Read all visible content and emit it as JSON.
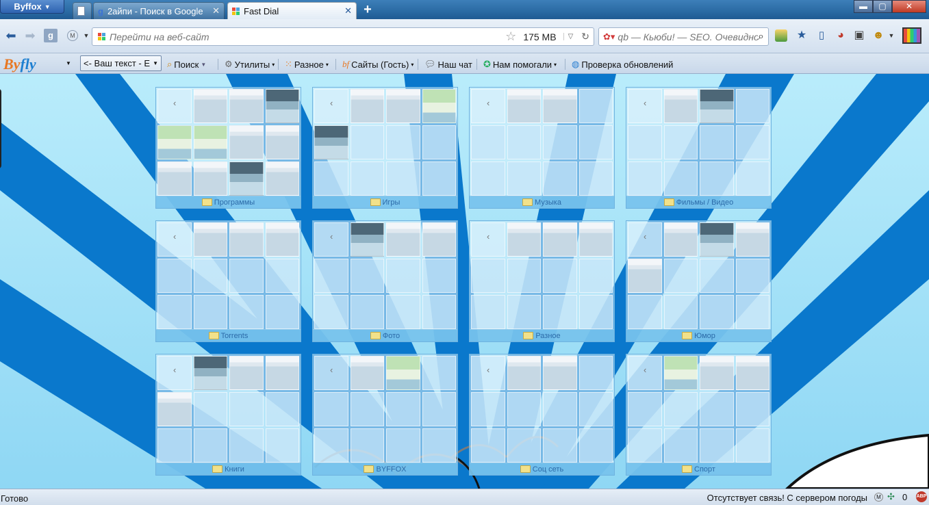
{
  "app": {
    "menu_label": "Byffox"
  },
  "tabs": [
    {
      "title": ""
    },
    {
      "title": "2айпи - Поиск в Google"
    },
    {
      "title": "Fast Dial"
    }
  ],
  "window_buttons": {
    "minimize": "▬",
    "maximize": "▢",
    "close": "✕"
  },
  "nav": {
    "url_placeholder": "Перейти на веб-сайт",
    "memory": "175 MB",
    "search_placeholder": "qb — Кьюби! — SEO. Очевидно",
    "identity_badge": "M"
  },
  "bookmarks": {
    "logo_b": "By",
    "logo_f": "fly",
    "your_text": "<- Ваш текст - E",
    "items": [
      {
        "label": "Поиск"
      },
      {
        "label": "Утилиты"
      },
      {
        "label": "Разное"
      },
      {
        "label": "Сайты (Гость)"
      },
      {
        "label": "Наш чат"
      },
      {
        "label": "Нам помогали"
      },
      {
        "label": "Проверка обновлений"
      }
    ]
  },
  "dials": [
    {
      "label": "Программы"
    },
    {
      "label": "Игры"
    },
    {
      "label": "Музыка"
    },
    {
      "label": "Фильмы / Видео"
    },
    {
      "label": "Torrents"
    },
    {
      "label": "Фото"
    },
    {
      "label": "Разное"
    },
    {
      "label": "Юмор"
    },
    {
      "label": "Книги"
    },
    {
      "label": "BYFFOX"
    },
    {
      "label": "Соц сеть"
    },
    {
      "label": "Спорт"
    }
  ],
  "status": {
    "left": "Готово",
    "right": "Отсутствует связь! С сервером погоды",
    "count": "0",
    "badge_m": "M",
    "badge_abp": "ABP"
  },
  "colors": {
    "accent": "#1c7ec8",
    "sky": "#5fc4ef"
  }
}
